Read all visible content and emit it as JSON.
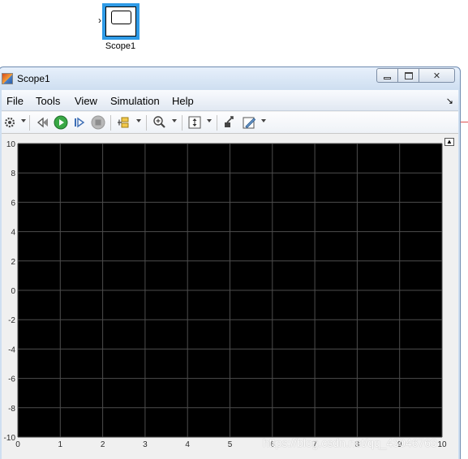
{
  "canvas": {
    "block": {
      "label": "Scope1",
      "icon": "scope-block-icon"
    },
    "signal_line_color": "#e05050"
  },
  "window": {
    "title": "Scope1",
    "controls": {
      "minimize": "minimize-icon",
      "maximize": "maximize-icon",
      "close": "✕"
    }
  },
  "menubar": {
    "items": [
      "File",
      "Tools",
      "View",
      "Simulation",
      "Help"
    ],
    "overflow_glyph": "↘"
  },
  "toolbar": {
    "icons": [
      "parameters-icon",
      "step-back-icon",
      "run-icon",
      "step-forward-icon",
      "stop-icon",
      "signal-selector-icon",
      "zoom-icon",
      "autoscale-icon",
      "highlight-block-icon",
      "style-icon"
    ]
  },
  "chart_data": {
    "type": "line",
    "title": "",
    "xlabel": "",
    "ylabel": "",
    "xlim": [
      0,
      10
    ],
    "ylim": [
      -10,
      10
    ],
    "x_ticks": [
      "0",
      "1",
      "2",
      "3",
      "4",
      "5",
      "6",
      "7",
      "8",
      "9",
      "10"
    ],
    "y_ticks": [
      "10",
      "8",
      "6",
      "4",
      "2",
      "0",
      "-2",
      "-4",
      "-6",
      "-8",
      "-10"
    ],
    "grid": true,
    "background": "#000000",
    "grid_color": "#4d4d4d",
    "series": []
  },
  "watermark": "https://blog.csdn.net/qq_43046763"
}
